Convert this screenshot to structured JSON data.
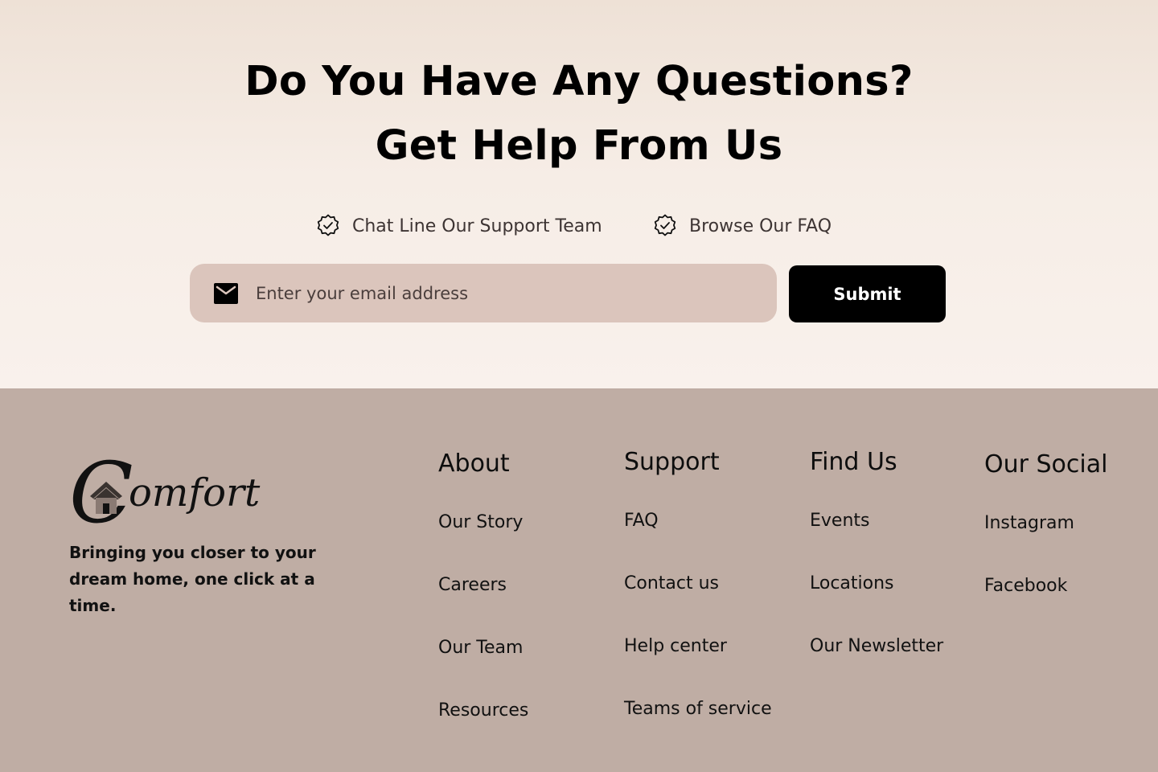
{
  "hero": {
    "title_line1": "Do You Have Any Questions?",
    "title_line2": "Get Help From Us",
    "links": [
      {
        "label": "Chat Line Our Support Team",
        "icon": "verified-badge-icon"
      },
      {
        "label": "Browse Our FAQ",
        "icon": "verified-badge-icon"
      }
    ],
    "email": {
      "placeholder": "Enter your email address",
      "value": "",
      "icon": "mail-icon"
    },
    "submit_label": "Submit"
  },
  "footer": {
    "logo_text": "Comfort",
    "tagline": "Bringing you closer to your dream home, one click at a time.",
    "columns": {
      "about": {
        "title": "About",
        "links": [
          "Our Story",
          "Careers",
          "Our Team",
          "Resources"
        ]
      },
      "support": {
        "title": "Support",
        "links": [
          "FAQ",
          "Contact us",
          "Help center",
          "Teams of service"
        ]
      },
      "find_us": {
        "title": "Find Us",
        "links": [
          "Events",
          "Locations",
          "Our Newsletter"
        ]
      },
      "social": {
        "title": "Our Social",
        "links": [
          "Instagram",
          "Facebook"
        ]
      }
    }
  },
  "colors": {
    "footer_bg": "#bfada4",
    "input_bg": "#dbc5bc",
    "button_bg": "#000000",
    "hero_top": "#eee1d6",
    "hero_bottom": "#f9f1ec"
  }
}
